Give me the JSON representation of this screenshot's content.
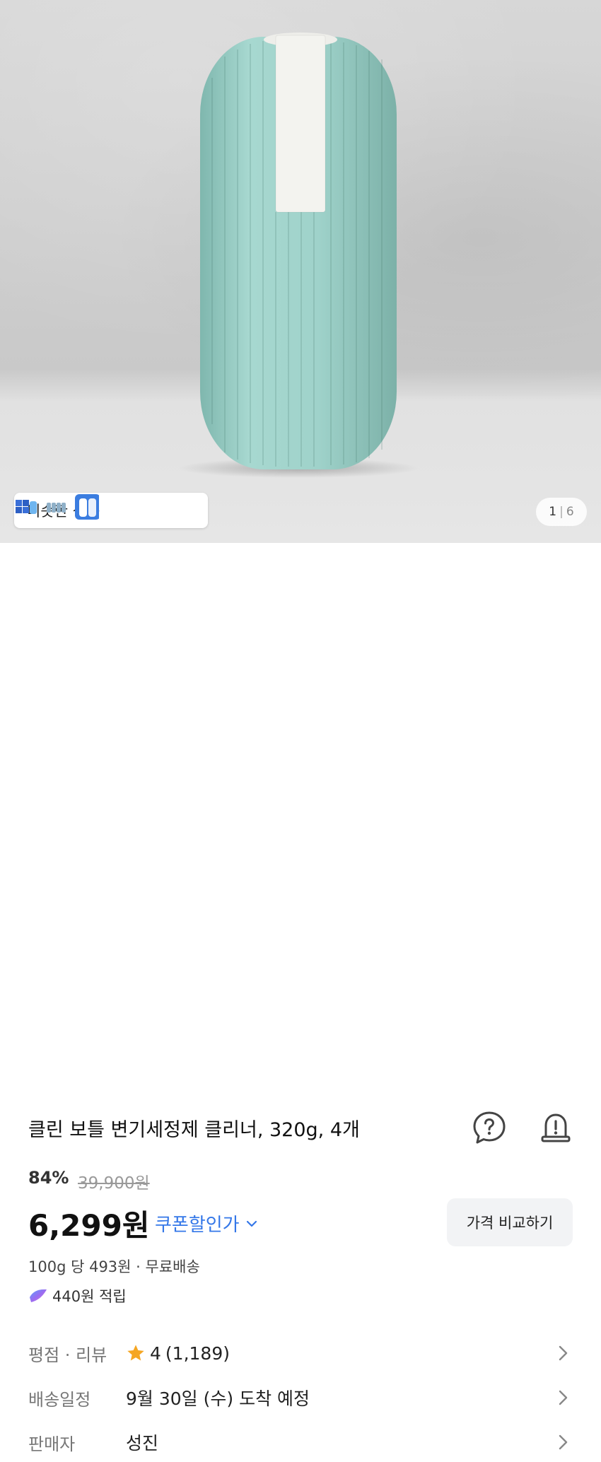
{
  "gallery": {
    "similar_label": "비슷한 상품",
    "page_current": "1",
    "page_separator": "|",
    "page_total": "6"
  },
  "product": {
    "title": "클린 보틀 변기세정제 클리너, 320g, 4개",
    "discount": "84%",
    "original_price": "39,900원",
    "price": "6,299원",
    "coupon_label": "쿠폰할인가",
    "compare_label": "가격 비교하기",
    "unit_line": "100g 당 493원 · 무료배송",
    "points": "440원 적립"
  },
  "details": {
    "rating": {
      "label": "평점 · 리뷰",
      "score": "4",
      "count": "(1,189)"
    },
    "delivery": {
      "label": "배송일정",
      "value": "9월 30일 (수) 도착 예정"
    },
    "seller": {
      "label": "판매자",
      "value": "성진"
    }
  },
  "colors": {
    "accent_blue": "#3477e8",
    "star": "#f5a623",
    "bottle": "#9cd1c9"
  },
  "icons": [
    "question-bubble-icon",
    "alarm-bell-icon",
    "chevron-down-icon",
    "chevron-right-icon",
    "star-icon",
    "points-icon"
  ]
}
